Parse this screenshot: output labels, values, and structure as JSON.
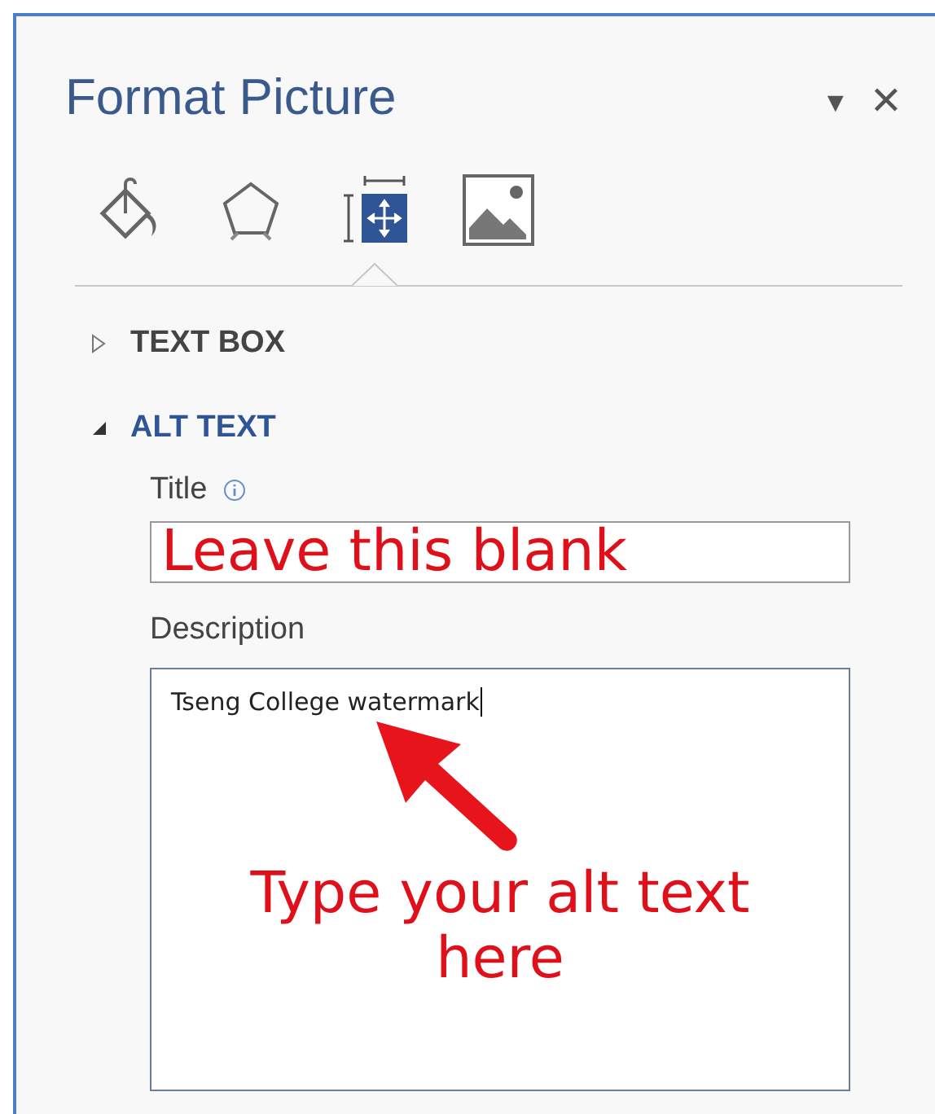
{
  "pane": {
    "title": "Format Picture",
    "menu_glyph": "▾",
    "close_glyph": "✕"
  },
  "tabs": [
    {
      "kind": "fill",
      "selected": false
    },
    {
      "kind": "effects",
      "selected": false
    },
    {
      "kind": "layout",
      "selected": true
    },
    {
      "kind": "picture",
      "selected": false
    }
  ],
  "sections": [
    {
      "label": "TEXT BOX",
      "expanded": false
    },
    {
      "label": "ALT TEXT",
      "expanded": true
    }
  ],
  "alt_text": {
    "title_label": "Title",
    "title_note": "Leave this blank",
    "description_label": "Description",
    "description_value": "Tseng College watermark",
    "description_note": "Type your alt text here"
  }
}
